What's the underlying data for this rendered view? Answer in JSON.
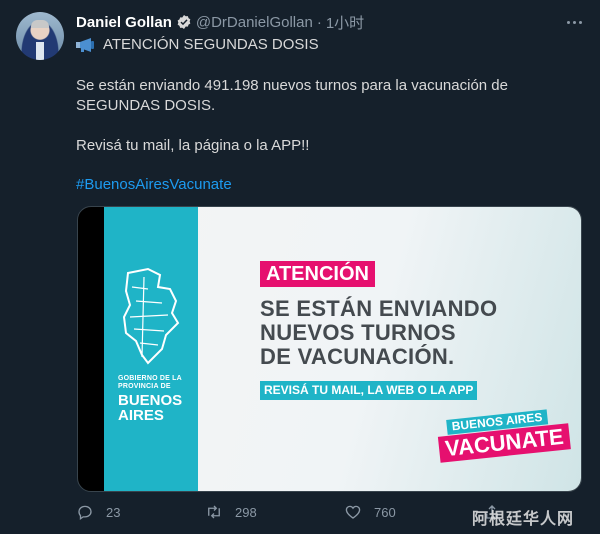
{
  "author": {
    "name": "Daniel Gollan",
    "handle": "@DrDanielGollan",
    "separator": "·",
    "time": "1小时",
    "verified": true
  },
  "tweet": {
    "line1": "ATENCIÓN SEGUNDAS DOSIS",
    "line2": "Se están enviando 491.198 nuevos turnos para la vacunación de SEGUNDAS DOSIS.",
    "line3": "Revisá tu mail, la página o la APP!!",
    "hashtag": "#BuenosAiresVacunate"
  },
  "card": {
    "gobierno": [
      "GOBIERNO DE LA",
      "PROVINCIA DE"
    ],
    "buenos": "BUENOS",
    "aires": "AIRES",
    "atencion": "ATENCIÓN",
    "headline": [
      "SE ESTÁN ENVIANDO",
      "NUEVOS TURNOS",
      "DE VACUNACIÓN."
    ],
    "sub": "REVISÁ TU MAIL, LA WEB O LA APP",
    "sticker_top": "BUENOS AIRES",
    "sticker_bottom": "VACUNATE"
  },
  "actions": {
    "reply_count": "23",
    "retweet_count": "298",
    "like_count": "760"
  },
  "watermark": "阿根廷华人网",
  "colors": {
    "background": "#15202b",
    "link": "#1d9bf0",
    "brand_cyan": "#1fb4c7",
    "brand_pink": "#e6106f"
  }
}
